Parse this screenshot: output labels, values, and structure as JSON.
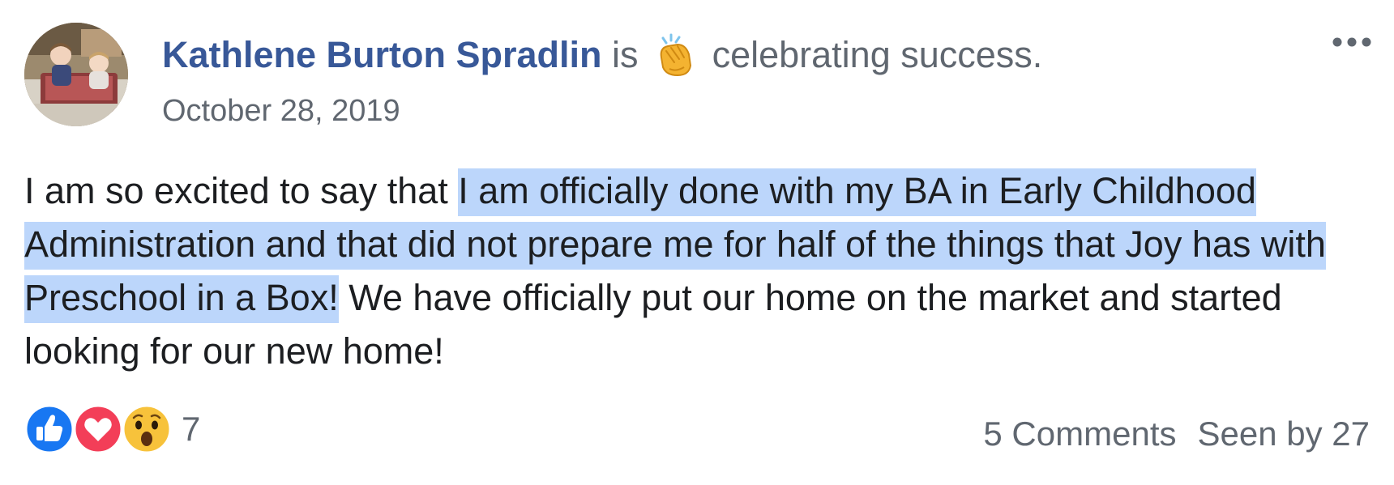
{
  "post": {
    "author": "Kathlene Burton Spradlin",
    "activity_verb": "is",
    "activity_emoji": "clapping-hands-icon",
    "activity_text": "celebrating success.",
    "timestamp": "October 28, 2019",
    "more_menu": "more-options-icon",
    "body": {
      "part1": "I am so excited to say that ",
      "highlighted": "I am officially done with my BA in Early Childhood Administration and that did not prepare me for half of the things that Joy has with Preschool in a Box!",
      "part2": " We have officially put our home on the market and started looking for our new home!"
    },
    "highlight_color": "#bcd6fb"
  },
  "footer": {
    "reactions": [
      "like-icon",
      "love-icon",
      "wow-icon"
    ],
    "reaction_count": "7",
    "comments": "5 Comments",
    "seen_by": "Seen by 27"
  },
  "colors": {
    "author": "#385898",
    "secondary_text": "#606770",
    "body_text": "#1c1e21",
    "like": "#1877f2",
    "love": "#f33e58"
  }
}
